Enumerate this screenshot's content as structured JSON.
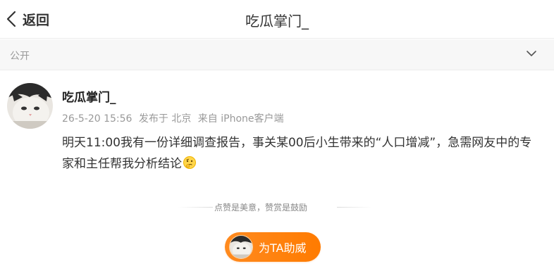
{
  "nav": {
    "back_label": "返回",
    "title": "吃瓜掌门_"
  },
  "visibility": {
    "label": "公开"
  },
  "post": {
    "author": "吃瓜掌门_",
    "time": "26-5-20 15:56",
    "location": "发布于 北京",
    "source": "来自 iPhone客户端",
    "text": "明天11:00我有一份详细调查报告，事关某00后小生带来的“人口增减”，急需网友中的专家和主任帮我分析结论",
    "emoji": "thinking-face-emoji"
  },
  "reward": {
    "divider_text": "点赞是美意，赞赏是鼓励",
    "button_label": "为TA助威"
  },
  "colors": {
    "accent_orange": "#ff8200",
    "text_primary": "#333333",
    "text_secondary": "#999999"
  }
}
